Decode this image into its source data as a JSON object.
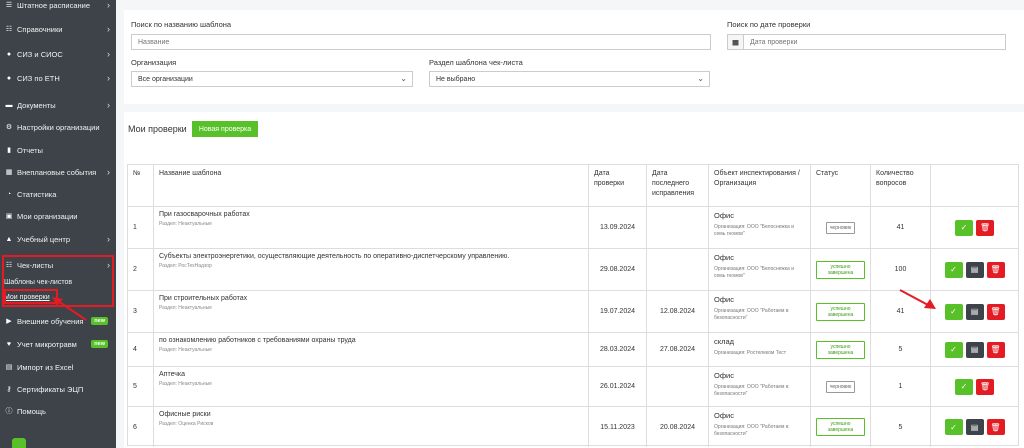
{
  "sidebar": {
    "items": [
      {
        "label": "Штатное расписание",
        "icon": "staff-icon",
        "chevron": true
      },
      {
        "label": "Справочники",
        "icon": "list-icon",
        "chevron": true
      },
      {
        "label": "СИЗ и СИОС",
        "icon": "ppe-icon",
        "chevron": true
      },
      {
        "label": "СИЗ по ЕТН",
        "icon": "ppe-etn-icon",
        "chevron": true
      },
      {
        "label": "Документы",
        "icon": "folder-icon",
        "chevron": true
      },
      {
        "label": "Настройки организации",
        "icon": "gear-icon",
        "chevron": false
      },
      {
        "label": "Отчеты",
        "icon": "report-icon",
        "chevron": false
      },
      {
        "label": "Внеплановые события",
        "icon": "event-icon",
        "chevron": true
      },
      {
        "label": "Статистика",
        "icon": "stats-icon",
        "chevron": false
      },
      {
        "label": "Мои организации",
        "icon": "org-icon",
        "chevron": false
      },
      {
        "label": "Учебный центр",
        "icon": "training-icon",
        "chevron": true
      },
      {
        "label": "Чек-листы",
        "icon": "checklist-icon",
        "chevron": true
      }
    ],
    "sub_items": [
      "Шаблоны чек-листов",
      "Мои проверки"
    ],
    "items_after": [
      {
        "label": "Внешние обучения",
        "icon": "external-training-icon",
        "badge": "new"
      },
      {
        "label": "Учет микротравм",
        "icon": "heart-icon",
        "badge": "new"
      },
      {
        "label": "Импорт из Excel",
        "icon": "excel-icon"
      },
      {
        "label": "Сертификаты ЭЦП",
        "icon": "key-icon"
      },
      {
        "label": "Помощь",
        "icon": "info-icon"
      }
    ]
  },
  "filters": {
    "name_label": "Поиск по названию шаблона",
    "name_placeholder": "Название",
    "date_label": "Поиск по дате проверки",
    "date_placeholder": "Дата проверки",
    "org_label": "Организация",
    "org_value": "Все организации",
    "section_label": "Раздел шаблона чек-листа",
    "section_value": "Не выбрано"
  },
  "main": {
    "title": "Мои проверки",
    "new_button": "Новая проверка",
    "columns": [
      "№",
      "Название шаблона",
      "Дата проверки",
      "Дата последнего исправления",
      "Объект инспектирования / Организация",
      "Статус",
      "Количество вопросов"
    ],
    "rows": [
      {
        "num": "1",
        "name": "При газосварочных работах",
        "section": "Раздел: Неактуальные",
        "date": "13.09.2024",
        "last_fix": "",
        "object": "Офис",
        "org": "Организация: ООО \"Белоснежка и семь гномов\"",
        "status": "черновик",
        "status_type": "draft",
        "questions": "41",
        "doc": false
      },
      {
        "num": "2",
        "name": "Субъекты электроэнергетики, осуществляющие деятельность по оперативно-диспетчерскому управлению.",
        "section": "Раздел: РосТехНадзор",
        "date": "29.08.2024",
        "last_fix": "",
        "object": "Офис",
        "org": "Организация: ООО \"Белоснежка и семь гномов\"",
        "status": "успешно завершена",
        "status_type": "done",
        "questions": "100",
        "doc": true
      },
      {
        "num": "3",
        "name": "При строительных работах",
        "section": "Раздел: Неактуальные",
        "date": "19.07.2024",
        "last_fix": "12.08.2024",
        "object": "Офис",
        "org": "Организация: ООО \"Работаем в безопасности\"",
        "status": "успешно завершена",
        "status_type": "done",
        "questions": "41",
        "doc": true
      },
      {
        "num": "4",
        "name": "по ознакомлению работников с требованиями охраны труда",
        "section": "Раздел: Неактуальные",
        "date": "28.03.2024",
        "last_fix": "27.08.2024",
        "object": "склад",
        "org": "Организация: Ростелеком Тест",
        "status": "успешно завершена",
        "status_type": "done",
        "questions": "5",
        "doc": true
      },
      {
        "num": "5",
        "name": "Аптечка",
        "section": "Раздел: Неактуальные",
        "date": "26.01.2024",
        "last_fix": "",
        "object": "Офис",
        "org": "Организация: ООО \"Работаем в безопасности\"",
        "status": "черновик",
        "status_type": "draft",
        "questions": "1",
        "doc": false
      },
      {
        "num": "6",
        "name": "Офисные риски",
        "section": "Раздел: Оценка Рисков",
        "date": "15.11.2023",
        "last_fix": "20.08.2024",
        "object": "Офис",
        "org": "Организация: ООО \"Работаем в безопасности\"",
        "status": "успешно завершена",
        "status_type": "done",
        "questions": "5",
        "doc": true
      }
    ]
  },
  "colors": {
    "sidebar": "#3d4349",
    "green": "#58c12a",
    "red": "#e31b23"
  }
}
